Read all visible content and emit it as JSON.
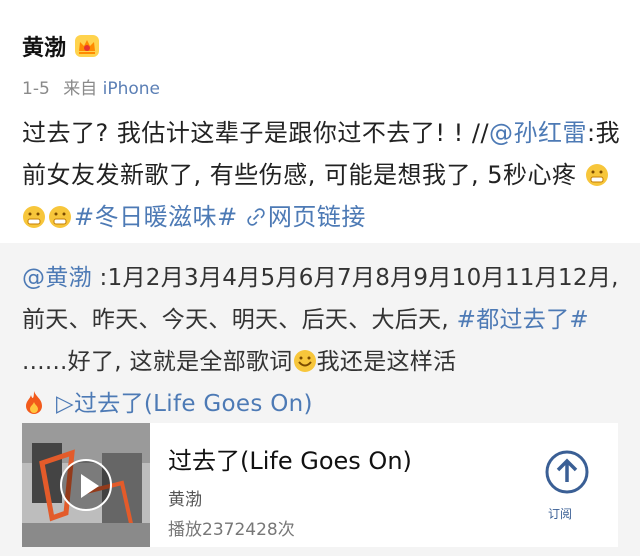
{
  "post": {
    "author": "黄渤",
    "meta": {
      "date": "1-5",
      "from": "来自",
      "device": "iPhone"
    },
    "body": {
      "part1": "过去了? 我估计这辈子是跟你过不去了! ! //",
      "mention": "@孙红雷",
      "part2": ":我前女友发新歌了, 有些伤感, 可能是想我了, 5秒心疼",
      "hashtag": "#冬日暖滋味#",
      "link_icon": "link-icon",
      "link_text": "网页链接"
    }
  },
  "repost": {
    "mention": "@黄渤",
    "text1": " :1月2月3月4月5月6月7月8月9月10月11月12月, 前天、昨天、今天、明天、后天、大后天, ",
    "hashtag": "#都过去了#",
    "text2": " ......好了, 这就是全部歌词",
    "text3": "我还是这样活",
    "song_link": "▷过去了(Life Goes On)",
    "music": {
      "title": "过去了(Life Goes On)",
      "artist": "黄渤",
      "plays": "播放2372428次",
      "button_label": "订阅"
    }
  },
  "colors": {
    "link": "#4d7ab5",
    "repost_bg": "#f4f4f4",
    "meta": "#8a8a8a"
  }
}
